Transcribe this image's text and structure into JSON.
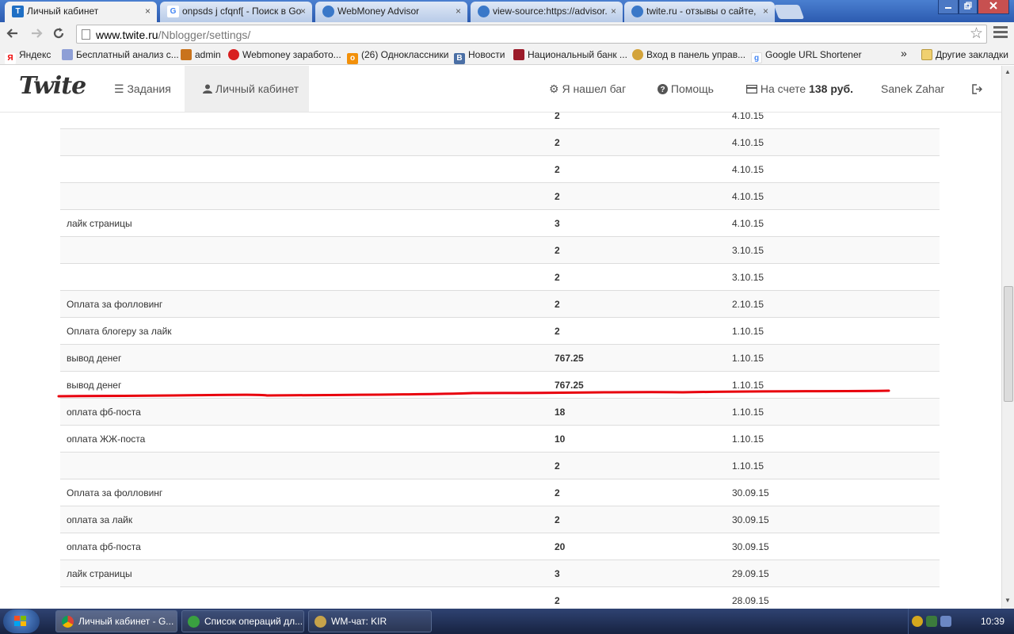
{
  "browser": {
    "tabs": [
      {
        "title": "Личный кабинет",
        "active": true
      },
      {
        "title": "onpsds j cfqnf[ - Поиск в Go",
        "active": false
      },
      {
        "title": "WebMoney Advisor",
        "active": false
      },
      {
        "title": "view-source:https://advisor.",
        "active": false
      },
      {
        "title": "twite.ru - отзывы о сайте, ",
        "active": false
      }
    ],
    "tab_close_glyph": "×",
    "url_host": "www.twite.ru",
    "url_path": "/Nblogger/settings/",
    "bookmarks": [
      "Яндекс",
      "Бесплатный анализ с...",
      "admin",
      "Webmoney заработо...",
      "(26) Одноклассники",
      "Новости",
      "Национальный банк ...",
      "Вход в панель управ...",
      "Google URL Shortener"
    ],
    "bookmarks_overflow": "»",
    "other_bookmarks": "Другие закладки"
  },
  "site": {
    "logo": "Twite",
    "nav": {
      "tasks": "Задания",
      "cabinet": "Личный кабинет",
      "bug": "Я нашел баг",
      "help": "Помощь",
      "balance_prefix": "На счете",
      "balance_value": "138 руб.",
      "user": "Sanek Zahar"
    }
  },
  "operations": [
    {
      "desc": "",
      "amount": "2",
      "date": "4.10.15"
    },
    {
      "desc": "",
      "amount": "2",
      "date": "4.10.15"
    },
    {
      "desc": "",
      "amount": "2",
      "date": "4.10.15"
    },
    {
      "desc": "",
      "amount": "2",
      "date": "4.10.15"
    },
    {
      "desc": "лайк страницы",
      "amount": "3",
      "date": "4.10.15"
    },
    {
      "desc": "",
      "amount": "2",
      "date": "3.10.15"
    },
    {
      "desc": "",
      "amount": "2",
      "date": "3.10.15"
    },
    {
      "desc": "Оплата за фолловинг",
      "amount": "2",
      "date": "2.10.15"
    },
    {
      "desc": "Оплата блогеру за лайк",
      "amount": "2",
      "date": "1.10.15"
    },
    {
      "desc": "вывод денег",
      "amount": "767.25",
      "date": "1.10.15"
    },
    {
      "desc": "вывод денег",
      "amount": "767.25",
      "date": "1.10.15"
    },
    {
      "desc": "оплата фб-поста",
      "amount": "18",
      "date": "1.10.15"
    },
    {
      "desc": "оплата ЖЖ-поста",
      "amount": "10",
      "date": "1.10.15"
    },
    {
      "desc": "",
      "amount": "2",
      "date": "1.10.15"
    },
    {
      "desc": "Оплата за фолловинг",
      "amount": "2",
      "date": "30.09.15"
    },
    {
      "desc": "оплата за лайк",
      "amount": "2",
      "date": "30.09.15"
    },
    {
      "desc": "оплата фб-поста",
      "amount": "20",
      "date": "30.09.15"
    },
    {
      "desc": "лайк страницы",
      "amount": "3",
      "date": "29.09.15"
    },
    {
      "desc": "",
      "amount": "2",
      "date": "28.09.15"
    }
  ],
  "taskbar": {
    "items": [
      "Личный кабинет - G...",
      "Список операций дл...",
      "WM-чат: KIR"
    ],
    "clock": "10:39"
  },
  "colors": {
    "highlight_line": "#e8000d",
    "tab_strip": "#2c5bb0",
    "taskbar": "#172341"
  }
}
